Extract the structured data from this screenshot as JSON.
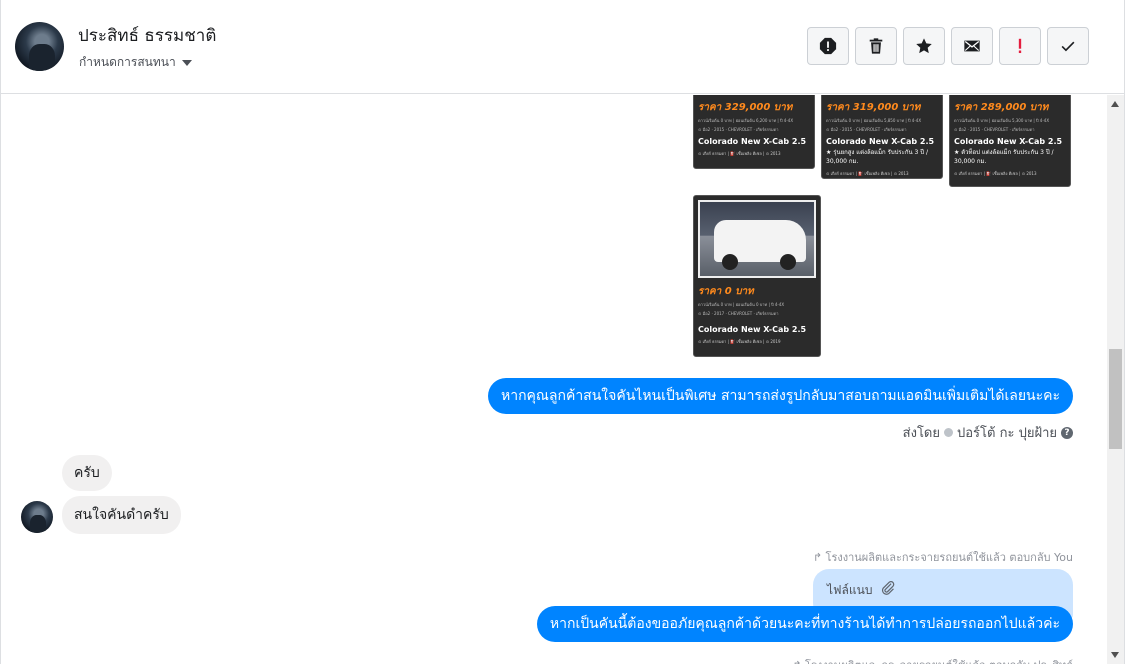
{
  "header": {
    "user_name": "ประสิทธ์ ธรรมชาติ",
    "manage_label": "กำหนดการสนทนา"
  },
  "toolbar": {
    "buttons": [
      {
        "name": "report-icon"
      },
      {
        "name": "trash-icon"
      },
      {
        "name": "star-icon"
      },
      {
        "name": "envelope-icon"
      },
      {
        "name": "exclamation-icon",
        "color": "#e41e3f"
      },
      {
        "name": "check-icon"
      }
    ]
  },
  "cards": [
    {
      "price": "ราคา 329,000 บาท",
      "model": "Colorado New X-Cab 2.5",
      "note": ""
    },
    {
      "price": "ราคา 319,000 บาท",
      "model": "Colorado New X-Cab 2.5",
      "note": "★ รุ่นยกสูง แต่งล้อแม็ก รับประกัน 3 ปี / 30,000 กม."
    },
    {
      "price": "ราคา 289,000 บาท",
      "model": "Colorado New X-Cab 2.5",
      "note": "★ ตัวท็อป แต่งล้อแม็ก รับประกัน 3 ปี / 30,000 กม."
    },
    {
      "price": "ราคา 0 บาท",
      "model": "Colorado New X-Cab 2.5",
      "note": ""
    }
  ],
  "messages": {
    "out_1": "หากคุณลูกค้าสนใจคันไหนเป็นพิเศษ สามารถส่งรูปกลับมาสอบถามแอดมินเพิ่มเติมได้เลยนะคะ",
    "sent_by_prefix": "ส่งโดย",
    "sent_by_name": "ปอร์โต้ กะ ปุยฝ้าย",
    "in_1": "ครับ",
    "in_2": "สนใจคันดำครับ",
    "replied_label": "↱ โรงงานผลิตและกระจายรถยนต์ใช้แล้ว ตอบกลับ You",
    "quoted_label": "ไฟล์แนบ",
    "out_2": "หากเป็นคันนี้ต้องขออภัยคุณลูกค้าด้วยนะคะที่ทางร้านได้ทำการปล่อยรถออกไปแล้วค่ะ",
    "replied_label_2": "↱ โรงงานผลิตและกระจายรถยนต์ใช้แล้ว ตอบกลับ ประสิทธ์"
  },
  "colors": {
    "accent": "#0084ff",
    "danger": "#e41e3f",
    "price": "#ff8a1d"
  }
}
